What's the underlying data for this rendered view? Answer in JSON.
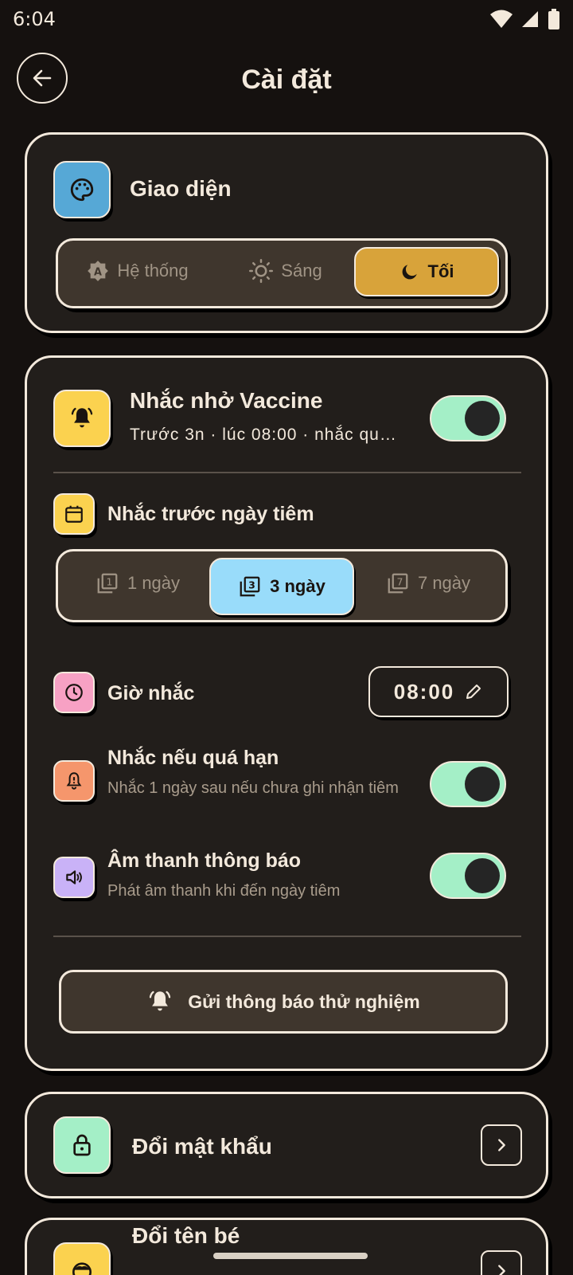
{
  "status_bar": {
    "time": "6:04"
  },
  "header": {
    "title": "Cài đặt"
  },
  "appearance": {
    "title": "Giao diện",
    "options": [
      {
        "label": "Hệ thống"
      },
      {
        "label": "Sáng"
      },
      {
        "label": "Tối"
      }
    ],
    "selected": "Tối"
  },
  "reminder": {
    "title": "Nhắc nhở Vaccine",
    "subtitle": "Trước 3n · lúc 08:00 · nhắc qu…",
    "enabled": true,
    "before_day_title": "Nhắc trước ngày tiêm",
    "day_options": [
      {
        "label": "1 ngày"
      },
      {
        "label": "3 ngày"
      },
      {
        "label": "7 ngày"
      }
    ],
    "selected_day": "3 ngày",
    "time_label": "Giờ nhắc",
    "time_value": "08:00",
    "overdue_title": "Nhắc nếu quá hạn",
    "overdue_sub": "Nhắc 1 ngày sau nếu chưa ghi nhận tiêm",
    "overdue_enabled": true,
    "sound_title": "Âm thanh thông báo",
    "sound_sub": "Phát âm thanh khi đến ngày tiêm",
    "sound_enabled": true,
    "test_button": "Gửi thông báo thử nghiệm"
  },
  "password": {
    "title": "Đổi mật khẩu"
  },
  "rename": {
    "title": "Đổi tên bé"
  },
  "colors": {
    "background": "#15110f",
    "card": "#221e1b",
    "accent_gold": "#d8a33a",
    "accent_blue": "#99dcfa",
    "toggle_on": "#a4efc7"
  }
}
